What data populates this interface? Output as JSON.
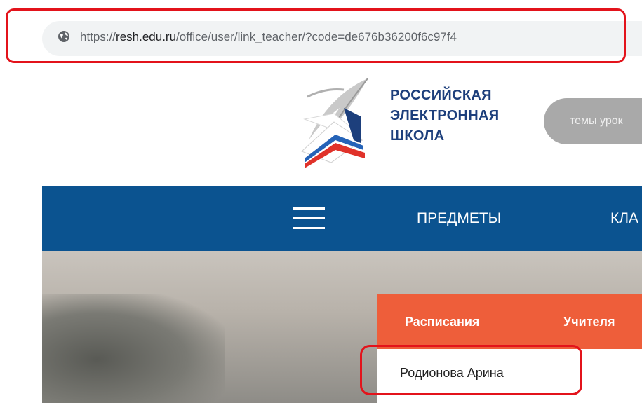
{
  "browser": {
    "url_prefix": "https://",
    "url_host": "resh.edu.ru",
    "url_path": "/office/user/link_teacher/?code=de676b36200f6c97f4",
    "site_icon": "globe-icon"
  },
  "header": {
    "logo_lines": [
      "РОССИЙСКАЯ",
      "ЭЛЕКТРОННАЯ",
      "ШКОЛА"
    ],
    "search_placeholder": "темы урок"
  },
  "nav": {
    "menu_icon": "hamburger-icon",
    "items": [
      "ПРЕДМЕТЫ",
      "КЛА"
    ]
  },
  "panel": {
    "tabs": [
      "Расписания",
      "Учителя"
    ],
    "teachers": [
      "Родионова Арина"
    ]
  },
  "colors": {
    "nav": "#0b5390",
    "panel_header": "#ee5e3a",
    "highlight": "#e3131b",
    "logo_text": "#1d3f7c"
  }
}
